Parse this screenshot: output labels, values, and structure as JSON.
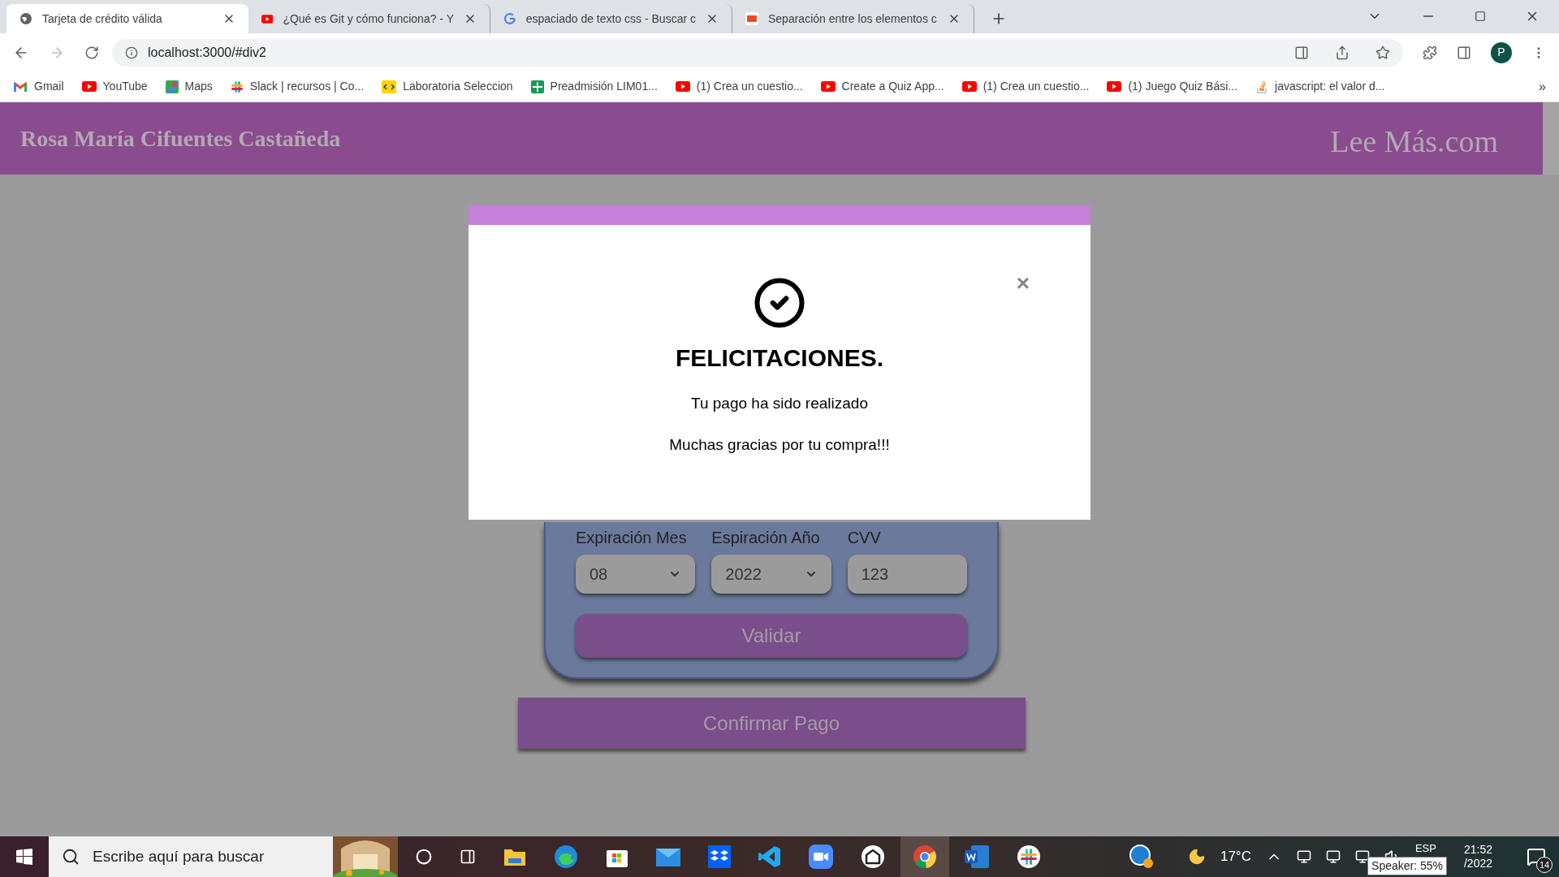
{
  "browser": {
    "tabs": [
      {
        "title": "Tarjeta de crédito válida",
        "kind": "globe",
        "selected": true
      },
      {
        "title": "¿Qué es Git y cómo funciona? - Y",
        "kind": "youtube",
        "selected": false
      },
      {
        "title": "espaciado de texto css - Buscar c",
        "kind": "google",
        "selected": false
      },
      {
        "title": "Separación entre los elementos c",
        "kind": "w3",
        "selected": false
      }
    ],
    "address": "localhost:3000/#div2",
    "profile": "P",
    "more_bookmarks": "»",
    "bookmarks": [
      {
        "label": "Gmail",
        "kind": "gmail"
      },
      {
        "label": "YouTube",
        "kind": "youtube"
      },
      {
        "label": "Maps",
        "kind": "maps"
      },
      {
        "label": "Slack | recursos | Co...",
        "kind": "slack"
      },
      {
        "label": "Laboratoria Seleccion",
        "kind": "lab"
      },
      {
        "label": "Preadmisión LIM01...",
        "kind": "sheets"
      },
      {
        "label": "(1) Crea un cuestio...",
        "kind": "youtube"
      },
      {
        "label": "Create a Quiz App...",
        "kind": "youtube"
      },
      {
        "label": "(1) Crea un cuestio...",
        "kind": "youtube"
      },
      {
        "label": "(1) Juego Quiz Bási...",
        "kind": "youtube"
      },
      {
        "label": "javascript: el valor d...",
        "kind": "stack"
      }
    ]
  },
  "header": {
    "name": "Rosa María Cifuentes Castañeda",
    "brand": "Lee Más.com"
  },
  "form": {
    "fields": [
      {
        "label": "Expiración Mes",
        "value": "08",
        "kind": "select"
      },
      {
        "label": "Espiración Año",
        "value": "2022",
        "kind": "select"
      },
      {
        "label": "CVV",
        "value": "123",
        "kind": "input"
      }
    ],
    "validate": "Validar",
    "confirm": "Confirmar Pago"
  },
  "modal": {
    "title": "FELICITACIONES.",
    "lines": [
      "Tu pago ha sido realizado",
      "Muchas gracias por tu compra!!!"
    ],
    "close": "×"
  },
  "taskbar": {
    "search_placeholder": "Escribe aquí para buscar",
    "temperature": "17°C",
    "language": "ESP",
    "time": "21:52",
    "date": "/2022",
    "tooltip": "Speaker: 55%",
    "notifications": "14"
  }
}
